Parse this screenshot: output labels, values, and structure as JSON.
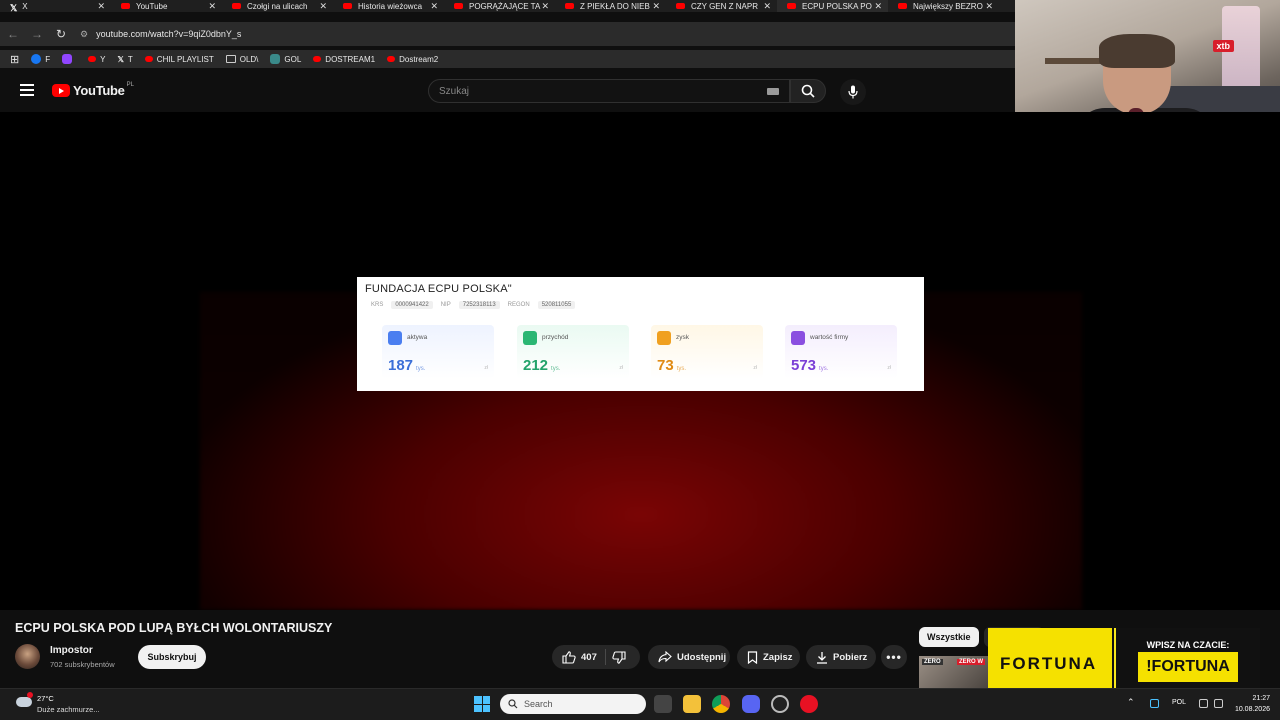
{
  "browser": {
    "tabs": [
      {
        "label": "X",
        "icon": "x-icon"
      },
      {
        "label": "YouTube",
        "icon": "youtube-icon"
      },
      {
        "label": "Czołgi na ulicach",
        "icon": "youtube-icon"
      },
      {
        "label": "Historia wieżowca",
        "icon": "youtube-icon"
      },
      {
        "label": "POGRĄŻAJĄCE TA",
        "icon": "youtube-icon"
      },
      {
        "label": "Z PIEKŁA DO NIEB",
        "icon": "youtube-icon"
      },
      {
        "label": "CZY GEN Z NAPR",
        "icon": "youtube-icon"
      },
      {
        "label": "ECPU POLSKA PO",
        "icon": "youtube-icon",
        "active": true
      },
      {
        "label": "Największy BEZRO",
        "icon": "youtube-icon"
      }
    ],
    "url": "youtube.com/watch?v=9qiZ0dbnY_s",
    "bookmarks": [
      {
        "label": "F",
        "icon": "facebook-icon"
      },
      {
        "label": "",
        "icon": "twitch-icon"
      },
      {
        "label": "Y",
        "icon": "youtube-icon"
      },
      {
        "label": "T",
        "icon": "x-icon"
      },
      {
        "label": "CHIL PLAYLIST",
        "icon": "youtube-icon"
      },
      {
        "label": "OLD\\",
        "icon": "folder-icon"
      },
      {
        "label": "GOL",
        "icon": "gol-icon"
      },
      {
        "label": "DOSTREAM1",
        "icon": "youtube-icon"
      },
      {
        "label": "Dostream2",
        "icon": "youtube-icon"
      }
    ]
  },
  "youtube": {
    "logo_text": "YouTube",
    "country_code": "PL",
    "search_placeholder": "Szukaj"
  },
  "video_frame": {
    "card_title": "FUNDACJA ECPU POLSKA\"",
    "ids": [
      {
        "label": "KRS",
        "value": "0000941422"
      },
      {
        "label": "NIP",
        "value": "7252318113"
      },
      {
        "label": "REGON",
        "value": "520811055"
      }
    ],
    "stats": [
      {
        "label": "aktywa",
        "value": "187",
        "unit": "tys.",
        "color": "#3b6fd8"
      },
      {
        "label": "przychód",
        "value": "212",
        "unit": "tys.",
        "color": "#23a36b"
      },
      {
        "label": "zysk",
        "value": "73",
        "unit": "tys.",
        "color": "#e08a12"
      },
      {
        "label": "wartość firmy",
        "value": "573",
        "unit": "tys.",
        "color": "#7b3fd6"
      }
    ],
    "currency": "zł"
  },
  "video_info": {
    "title": "ECPU POLSKA POD LUPĄ BYŁCH WOLONTARIUSZY",
    "channel_name": "Impostor",
    "subscribers": "702 subskrybentów",
    "subscribe_label": "Subskrybuj",
    "likes": "407",
    "share_label": "Udostępnij",
    "save_label": "Zapisz",
    "download_label": "Pobierz"
  },
  "sidebar": {
    "chip_all": "Wszystkie",
    "thumb_text_1": "ZERO",
    "thumb_text_2": "ZERO W"
  },
  "ad": {
    "brand": "FORTUNA",
    "call_to_action": "WPISZ NA CZACIE:",
    "command": "!FORTUNA"
  },
  "overlay": {
    "webcam_badge": "xtb"
  },
  "taskbar": {
    "temperature": "27°C",
    "weather": "Duże zachmurze...",
    "search_placeholder": "Search",
    "language": "POL",
    "time": "21:27",
    "date": "10.08.2026"
  }
}
